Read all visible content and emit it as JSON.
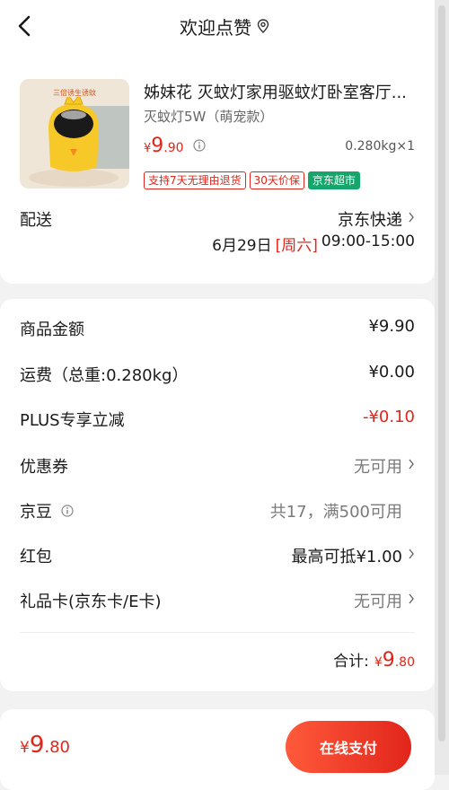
{
  "header": {
    "title": "欢迎点赞"
  },
  "product": {
    "title": "姊妹花 灭蚊灯家用驱蚊灯卧室客厅...",
    "spec": "灭蚊灯5W（萌宠款）",
    "price_symbol": "¥",
    "price_int": "9",
    "price_dec": ".90",
    "weight_qty": "0.280kg×1",
    "thumb_caption": "三倍诱生诱蚊",
    "tags": [
      "支持7天无理由退货",
      "30天价保",
      "京东超市"
    ]
  },
  "delivery": {
    "label": "配送",
    "method": "京东快递",
    "date": "6月29日",
    "weekday": "[周六]",
    "time": "09:00-15:00"
  },
  "summary": {
    "rows": [
      {
        "label": "商品金额",
        "value": "¥9.90"
      },
      {
        "label": "运费（总重:0.280kg）",
        "value": "¥0.00"
      },
      {
        "label": "PLUS专享立减",
        "value": "-¥0.10"
      },
      {
        "label": "优惠券",
        "value": "无可用"
      },
      {
        "label": "京豆",
        "value": "共17，满500可用"
      },
      {
        "label": "红包",
        "value": "最高可抵¥1.00"
      },
      {
        "label": "礼品卡(京东卡/E卡)",
        "value": "无可用"
      }
    ],
    "total_label": "合计:",
    "total_symbol": "¥",
    "total_int": "9",
    "total_dec": ".80"
  },
  "footer": {
    "price_symbol": "¥",
    "price_int": "9",
    "price_dec": ".80",
    "pay_label": "在线支付"
  },
  "colors": {
    "accent": "#e1251b",
    "green_tag": "#16a66b"
  }
}
